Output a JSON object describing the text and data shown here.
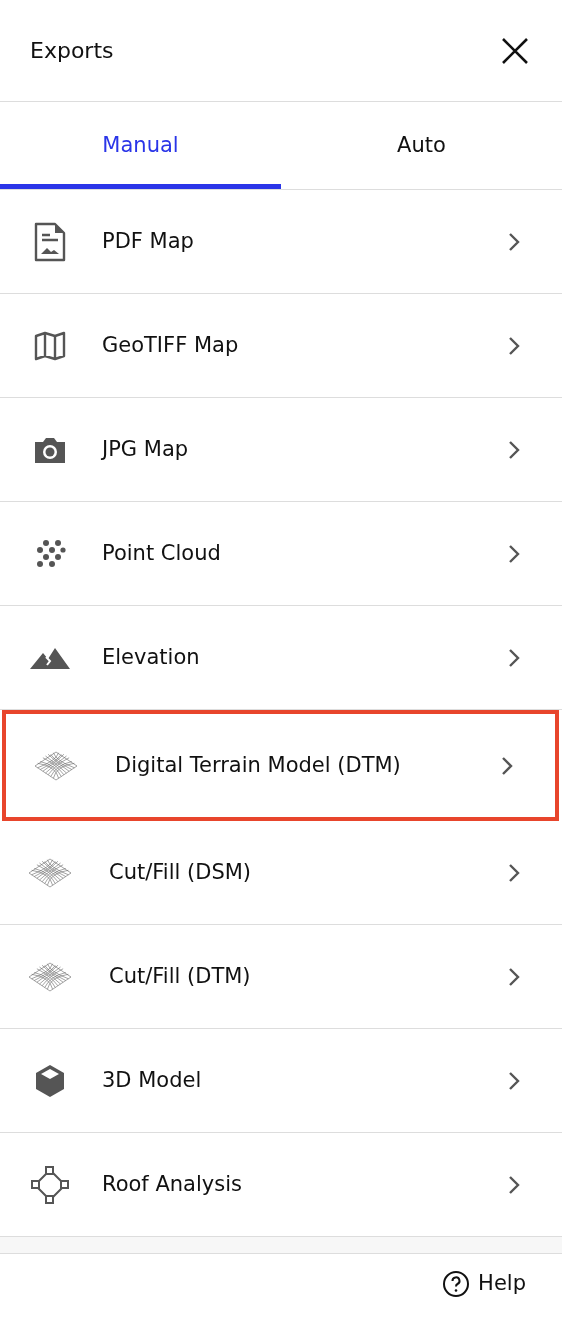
{
  "header": {
    "title": "Exports"
  },
  "tabs": [
    {
      "label": "Manual",
      "selected": true
    },
    {
      "label": "Auto",
      "selected": false
    }
  ],
  "items": [
    {
      "kind": "pdf",
      "label": "PDF Map",
      "highlighted": false
    },
    {
      "kind": "map",
      "label": "GeoTIFF Map",
      "highlighted": false
    },
    {
      "kind": "camera",
      "label": "JPG Map",
      "highlighted": false
    },
    {
      "kind": "points",
      "label": "Point Cloud",
      "highlighted": false
    },
    {
      "kind": "elevation",
      "label": "Elevation",
      "highlighted": false
    },
    {
      "kind": "mesh",
      "label": "Digital Terrain Model (DTM)",
      "highlighted": true
    },
    {
      "kind": "mesh",
      "label": "Cut/Fill (DSM)",
      "highlighted": false
    },
    {
      "kind": "mesh",
      "label": "Cut/Fill (DTM)",
      "highlighted": false
    },
    {
      "kind": "cube",
      "label": "3D Model",
      "highlighted": false
    },
    {
      "kind": "roof",
      "label": "Roof Analysis",
      "highlighted": false
    }
  ],
  "footer": {
    "help": "Help"
  }
}
